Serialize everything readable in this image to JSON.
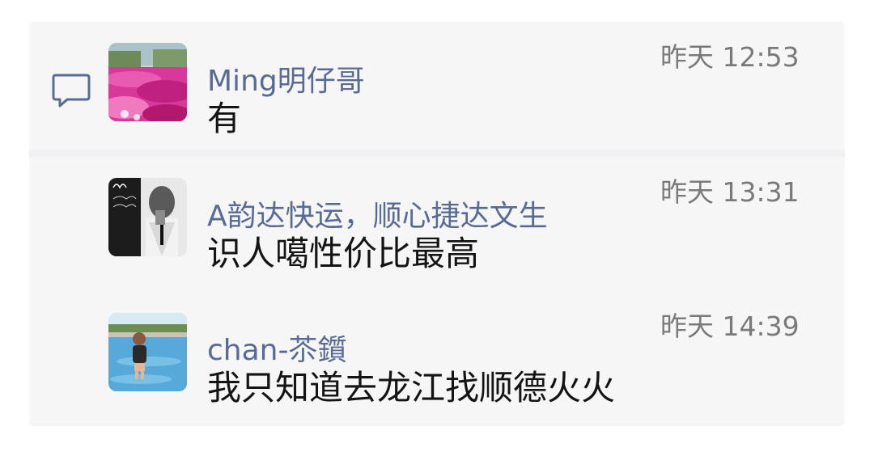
{
  "comments": [
    {
      "author": "Ming明仔哥",
      "time": "昨天 12:53",
      "text": "有",
      "avatar": "avatar-pink-flower-field"
    },
    {
      "author": "A韵达快运，顺心捷达文生",
      "time": "昨天 13:31",
      "text": "识人噶性价比最高",
      "avatar": "avatar-bw-portrait"
    },
    {
      "author": "chan-苶鑕",
      "time": "昨天 14:39",
      "text": "我只知道去龙江找顺德火火",
      "avatar": "avatar-child-pool"
    }
  ],
  "icons": {
    "comment": "comment-bubble-icon"
  },
  "colors": {
    "author": "#576b95",
    "time": "#7a7a7a",
    "text": "#141414",
    "panel_bg": "#f6f6f7"
  }
}
